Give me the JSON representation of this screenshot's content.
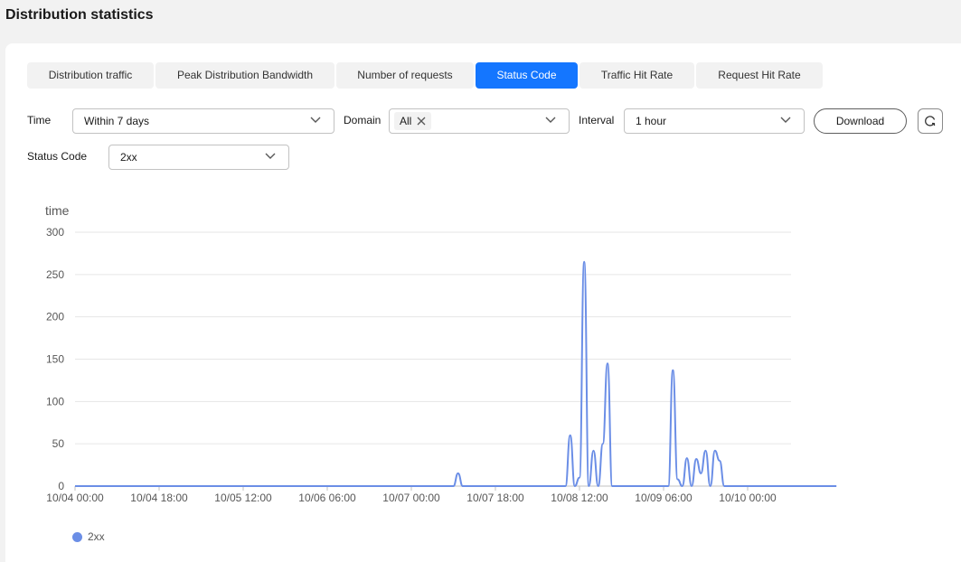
{
  "page": {
    "title": "Distribution statistics"
  },
  "tabs": [
    {
      "label": "Distribution traffic",
      "active": false
    },
    {
      "label": "Peak Distribution Bandwidth",
      "active": false
    },
    {
      "label": "Number of requests",
      "active": false
    },
    {
      "label": "Status Code",
      "active": true
    },
    {
      "label": "Traffic Hit Rate",
      "active": false
    },
    {
      "label": "Request Hit Rate",
      "active": false
    }
  ],
  "filters": {
    "time": {
      "label": "Time",
      "value": "Within 7 days"
    },
    "domain": {
      "label": "Domain",
      "tag": "All"
    },
    "interval": {
      "label": "Interval",
      "value": "1 hour"
    },
    "status_code": {
      "label": "Status Code",
      "value": "2xx"
    }
  },
  "actions": {
    "download": "Download"
  },
  "colors": {
    "accent": "#1476ff",
    "series": "#6b8ee6",
    "grid": "#e6e6e6"
  },
  "chart_data": {
    "type": "line",
    "ylabel": "time",
    "ylim": [
      0,
      300
    ],
    "yticks": [
      0,
      50,
      100,
      150,
      200,
      250,
      300
    ],
    "xticks": [
      "10/04 00:00",
      "10/04 18:00",
      "10/05 12:00",
      "10/06 06:00",
      "10/07 00:00",
      "10/07 18:00",
      "10/08 12:00",
      "10/09 06:00",
      "10/10 00:00"
    ],
    "x_start": "10/04 00:00",
    "x_end": "10/10 19:00",
    "grid": true,
    "legend_position": "bottom-left",
    "series": [
      {
        "name": "2xx",
        "points": [
          [
            "10/04 00:00",
            0
          ],
          [
            "10/07 09:00",
            0
          ],
          [
            "10/07 10:00",
            15
          ],
          [
            "10/07 11:00",
            0
          ],
          [
            "10/08 09:00",
            0
          ],
          [
            "10/08 10:00",
            60
          ],
          [
            "10/08 11:00",
            0
          ],
          [
            "10/08 12:00",
            10
          ],
          [
            "10/08 13:00",
            265
          ],
          [
            "10/08 14:00",
            0
          ],
          [
            "10/08 15:00",
            42
          ],
          [
            "10/08 16:00",
            0
          ],
          [
            "10/08 17:00",
            50
          ],
          [
            "10/08 18:00",
            145
          ],
          [
            "10/08 19:00",
            0
          ],
          [
            "10/09 07:00",
            0
          ],
          [
            "10/09 08:00",
            137
          ],
          [
            "10/09 09:00",
            8
          ],
          [
            "10/09 10:00",
            0
          ],
          [
            "10/09 11:00",
            33
          ],
          [
            "10/09 12:00",
            0
          ],
          [
            "10/09 13:00",
            32
          ],
          [
            "10/09 14:00",
            15
          ],
          [
            "10/09 15:00",
            42
          ],
          [
            "10/09 16:00",
            0
          ],
          [
            "10/09 17:00",
            42
          ],
          [
            "10/09 18:00",
            30
          ],
          [
            "10/09 19:00",
            0
          ],
          [
            "10/10 19:00",
            0
          ]
        ]
      }
    ]
  }
}
